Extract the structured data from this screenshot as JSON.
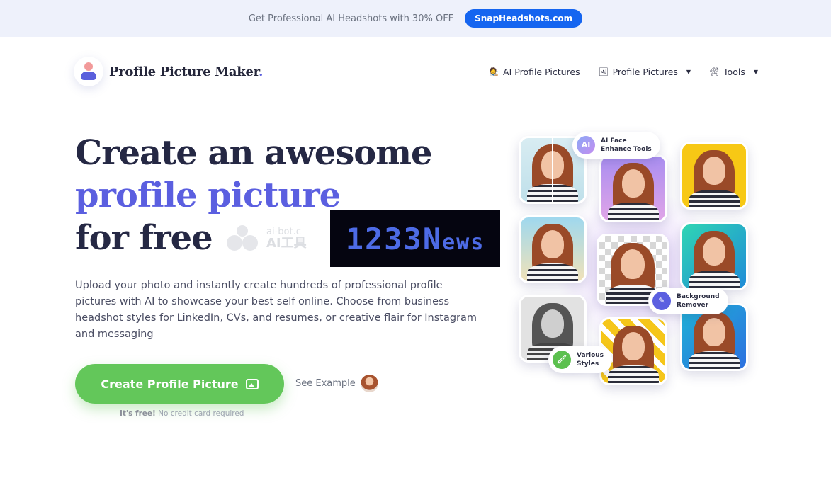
{
  "promo": {
    "text": "Get Professional AI Headshots with 30% OFF",
    "button": "SnapHeadshots.com"
  },
  "brand": {
    "name": "Profile Picture Maker",
    "dot": "."
  },
  "nav": {
    "items": [
      {
        "label": "AI Profile Pictures",
        "icon": "🧑‍🎨"
      },
      {
        "label": "Profile Pictures",
        "icon": "🖼",
        "caret": "▼"
      },
      {
        "label": "Tools",
        "icon": "🛠",
        "caret": "▼"
      }
    ]
  },
  "hero": {
    "line1": "Create an awesome",
    "line2": "profile picture",
    "line3": "for free",
    "description": "Upload your photo and instantly create hundreds of professional profile pictures with AI to showcase your best self online. Choose from business headshot styles for LinkedIn, CVs, and resumes, or creative flair for Instagram and messaging",
    "cta": "Create Profile Picture",
    "see_example": "See Example",
    "free_strong": "It's free!",
    "free_rest": " No credit card required"
  },
  "watermark": {
    "line1": "ai-bot.c",
    "line2": "AI工具",
    "news_main": "1233N",
    "news_small": "ews"
  },
  "collage": {
    "badge_ai_icon": "AI",
    "badge_ai_line1": "AI Face",
    "badge_ai_line2": "Enhance Tools",
    "badge_bg_line1": "Background",
    "badge_bg_line2": "Remover",
    "badge_styles_line1": "Various",
    "badge_styles_line2": "Styles"
  },
  "colors": {
    "accent": "#5b5fe0",
    "cta_green": "#63c75a",
    "promo_button": "#1565f0"
  }
}
